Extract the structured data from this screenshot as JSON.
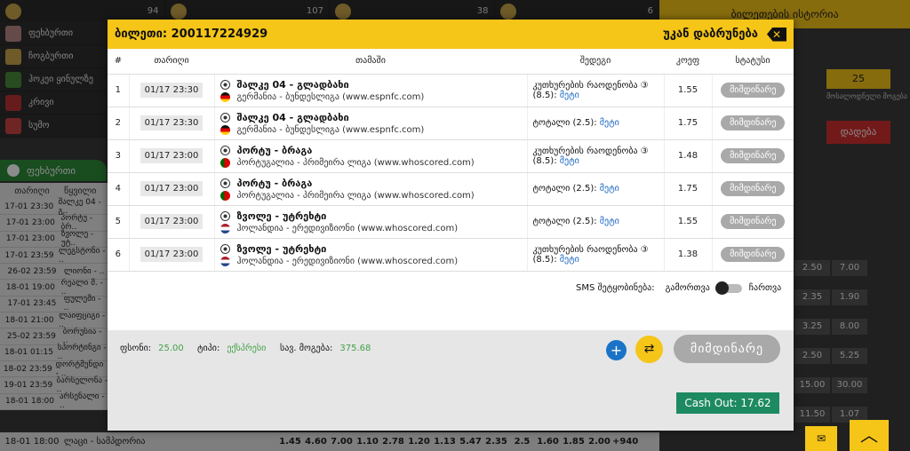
{
  "background": {
    "top_counts": [
      "94",
      "107",
      "38",
      "6"
    ],
    "nav_items": [
      "ფეხბურთი",
      "ჩოგბურთი",
      "ჰოკეი ყინულზე",
      "კრივი",
      "სუმო"
    ],
    "sport_tab": "ფეხბურთი",
    "table_headers": [
      "თარიღი",
      "წყვილი"
    ],
    "rows": [
      [
        "17-01 23:30",
        "შალკე 04 - გ.."
      ],
      [
        "17-01 23:00",
        "პორტუ - ბრ.."
      ],
      [
        "17-01 23:00",
        "ზვოლე - უტ.."
      ],
      [
        "17-01 23:59",
        "ლეგსტონი - .."
      ],
      [
        "26-02 23:59",
        "ლიონი - .."
      ],
      [
        "18-01 19:00",
        "რეალი მ. - .."
      ],
      [
        "17-01 23:45",
        "ფულემი - .."
      ],
      [
        "18-01 21:00",
        "ლაიფციგი - .."
      ],
      [
        "25-02 23:59",
        "ბორუსია - .."
      ],
      [
        "18-01 01:15",
        "სპორტინგი - .."
      ],
      [
        "18-02 23:59",
        "დორტმუნდი - .."
      ],
      [
        "19-01 23:59",
        "ბარსელონა - .."
      ],
      [
        "18-01 18:00",
        "არსენალი - .."
      ]
    ],
    "bottom_row": {
      "date": "18-01 18:00",
      "pair": "ლაცი - სამპდორია",
      "odds": [
        "1.45",
        "4.60",
        "7.00",
        "1.10",
        "2.78",
        "1.20",
        "1.13",
        "5.47",
        "2.35",
        "2.5",
        "1.60",
        "1.85",
        "2.00",
        "+940"
      ]
    },
    "right_panel": {
      "title": "ბილეთების ისტორია",
      "stake_value": "25",
      "stake_label": "მოსალოდნელი მოგება",
      "bet_button": "დადება",
      "rows": [
        [
          "2.50",
          "7.00"
        ],
        [
          "2.35",
          "1.90"
        ],
        [
          "3.25",
          "8.00"
        ],
        [
          "2.50",
          "5.25"
        ],
        [
          "15.00",
          "30.00"
        ],
        [
          "11.50",
          "1.07"
        ]
      ]
    }
  },
  "modal": {
    "title": "ბილეთი: 200117224929",
    "back_label": "უკან დაბრუნება",
    "columns": [
      "#",
      "თარიღი",
      "თამაში",
      "შედეგი",
      "კოეფ",
      "სტატუსი"
    ],
    "rows": [
      {
        "num": "1",
        "date": "01/17 23:30",
        "teams": "შალკე 04 - გლადბახი",
        "league": "გერმანია - ბუნდესლიგა (www.espnfc.com)",
        "flag": "de",
        "result": "კუთხურების რაოდენობა ③ (8.5):",
        "pick": "მეტი",
        "odd": "1.55",
        "status": "მიმდინარე"
      },
      {
        "num": "2",
        "date": "01/17 23:30",
        "teams": "შალკე 04 - გლადბახი",
        "league": "გერმანია - ბუნდესლიგა (www.espnfc.com)",
        "flag": "de",
        "result": "ტოტალი (2.5):",
        "pick": "მეტი",
        "odd": "1.75",
        "status": "მიმდინარე"
      },
      {
        "num": "3",
        "date": "01/17 23:00",
        "teams": "პორტუ - ბრაგა",
        "league": "პორტუგალია - პრიმეირა ლიგა (www.whoscored.com)",
        "flag": "pt",
        "result": "კუთხურების რაოდენობა ③ (8.5):",
        "pick": "მეტი",
        "odd": "1.48",
        "status": "მიმდინარე"
      },
      {
        "num": "4",
        "date": "01/17 23:00",
        "teams": "პორტუ - ბრაგა",
        "league": "პორტუგალია - პრიმეირა ლიგა (www.whoscored.com)",
        "flag": "pt",
        "result": "ტოტალი (2.5):",
        "pick": "მეტი",
        "odd": "1.75",
        "status": "მიმდინარე"
      },
      {
        "num": "5",
        "date": "01/17 23:00",
        "teams": "ზვოლე - უტრეხტი",
        "league": "ჰოლანდია - ერედივიზიონი (www.whoscored.com)",
        "flag": "nl",
        "result": "ტოტალი (2.5):",
        "pick": "მეტი",
        "odd": "1.55",
        "status": "მიმდინარე"
      },
      {
        "num": "6",
        "date": "01/17 23:00",
        "teams": "ზვოლე - უტრეხტი",
        "league": "ჰოლანდია - ერედივიზიონი (www.whoscored.com)",
        "flag": "nl",
        "result": "კუთხურების რაოდენობა ③ (8.5):",
        "pick": "მეტი",
        "odd": "1.38",
        "status": "მიმდინარე"
      }
    ],
    "sms_label": "SMS შეტყობინება:",
    "sms_off": "გამორთვა",
    "sms_on": "ჩართვა",
    "stake_label": "ფსონი:",
    "stake_value": "25.00",
    "type_label": "ტიპი:",
    "type_value": "ექსპრესი",
    "win_label": "სავ. მოგება:",
    "win_value": "375.68",
    "status_button": "მიმდინარე",
    "cashout_label": "Cash Out: 17.62"
  }
}
